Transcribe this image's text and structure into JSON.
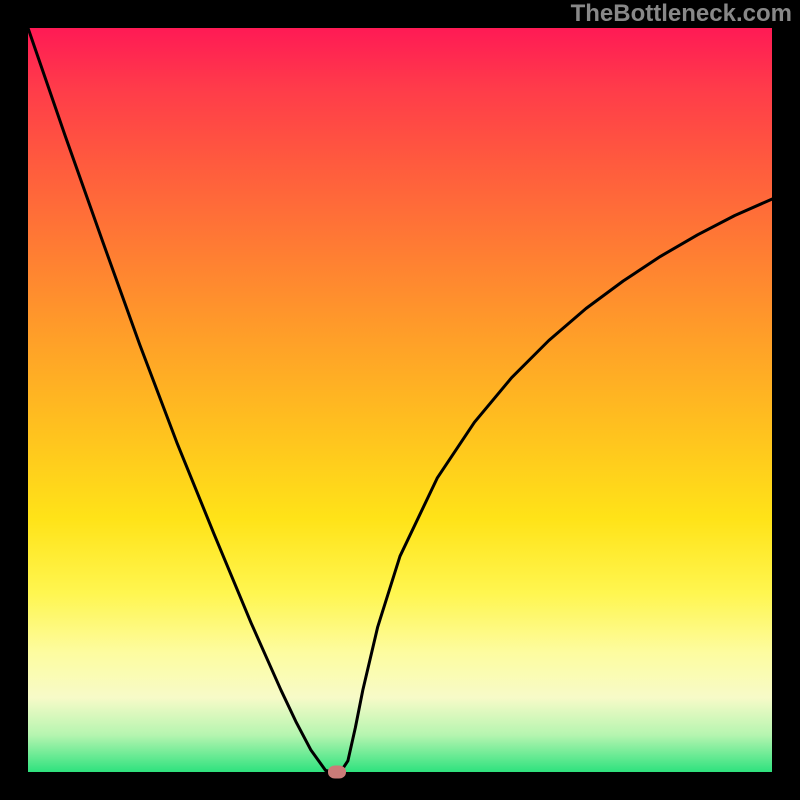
{
  "watermark": "TheBottleneck.com",
  "chart_data": {
    "type": "line",
    "title": "",
    "xlabel": "",
    "ylabel": "",
    "xlim": [
      0,
      1
    ],
    "ylim": [
      0,
      1
    ],
    "series": [
      {
        "name": "curve",
        "x": [
          0.0,
          0.05,
          0.1,
          0.15,
          0.2,
          0.25,
          0.3,
          0.32,
          0.34,
          0.36,
          0.38,
          0.4,
          0.41,
          0.42,
          0.43,
          0.44,
          0.45,
          0.47,
          0.5,
          0.55,
          0.6,
          0.65,
          0.7,
          0.75,
          0.8,
          0.85,
          0.9,
          0.95,
          1.0
        ],
        "values": [
          1.0,
          0.855,
          0.714,
          0.575,
          0.443,
          0.32,
          0.2,
          0.155,
          0.11,
          0.068,
          0.03,
          0.002,
          0.0,
          0.0,
          0.015,
          0.06,
          0.11,
          0.195,
          0.29,
          0.395,
          0.47,
          0.53,
          0.58,
          0.623,
          0.66,
          0.693,
          0.722,
          0.748,
          0.77
        ]
      }
    ],
    "annotations": [
      {
        "name": "marker",
        "x": 0.415,
        "y": 0.0
      }
    ],
    "background_gradient_stops": [
      {
        "pos": 0.0,
        "color": "#ff1a55"
      },
      {
        "pos": 0.5,
        "color": "#ffc41e"
      },
      {
        "pos": 0.8,
        "color": "#fdfca0"
      },
      {
        "pos": 1.0,
        "color": "#2ee27e"
      }
    ]
  }
}
